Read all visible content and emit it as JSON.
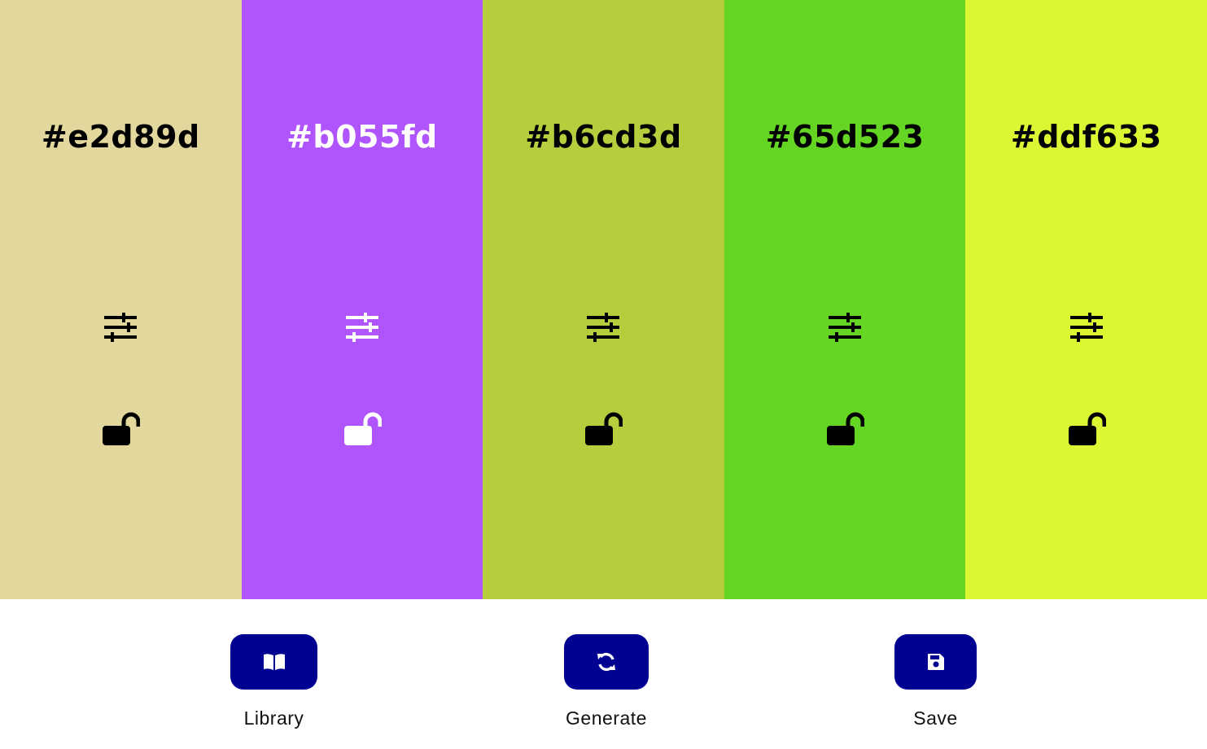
{
  "palette": {
    "swatches": [
      {
        "hex": "#e2d89d",
        "text_color": "#000000"
      },
      {
        "hex": "#b055fd",
        "text_color": "#ffffff"
      },
      {
        "hex": "#b6cd3d",
        "text_color": "#000000"
      },
      {
        "hex": "#65d523",
        "text_color": "#000000"
      },
      {
        "hex": "#ddf633",
        "text_color": "#000000"
      }
    ],
    "adjust_icon": "sliders-icon",
    "lock_icon": "unlock-icon"
  },
  "panel": {
    "button_color": "#000091",
    "library": {
      "label": "Library",
      "icon": "book-icon"
    },
    "generate": {
      "label": "Generate",
      "icon": "refresh-icon"
    },
    "save": {
      "label": "Save",
      "icon": "save-icon"
    }
  }
}
